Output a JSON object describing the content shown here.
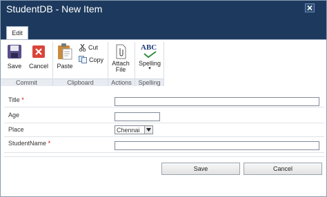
{
  "window": {
    "title": "StudentDB - New Item"
  },
  "ribbon": {
    "tab_label": "Edit",
    "groups": {
      "commit": "Commit",
      "clipboard": "Clipboard",
      "actions": "Actions",
      "spelling": "Spelling"
    },
    "buttons": {
      "save": "Save",
      "cancel": "Cancel",
      "paste": "Paste",
      "cut": "Cut",
      "copy": "Copy",
      "attach_line1": "Attach",
      "attach_line2": "File",
      "spelling": "Spelling",
      "spelling_icon_text": "ABC"
    }
  },
  "form": {
    "fields": [
      {
        "label": "Title",
        "required": "*",
        "value": ""
      },
      {
        "label": "Age",
        "required": "",
        "value": ""
      },
      {
        "label": "Place",
        "required": "",
        "value": "Chennai"
      },
      {
        "label": "StudentName",
        "required": "*",
        "value": ""
      }
    ]
  },
  "actions": {
    "save": "Save",
    "cancel": "Cancel"
  },
  "colors": {
    "titlebar": "#1d3a5e",
    "required": "#cc0000"
  }
}
